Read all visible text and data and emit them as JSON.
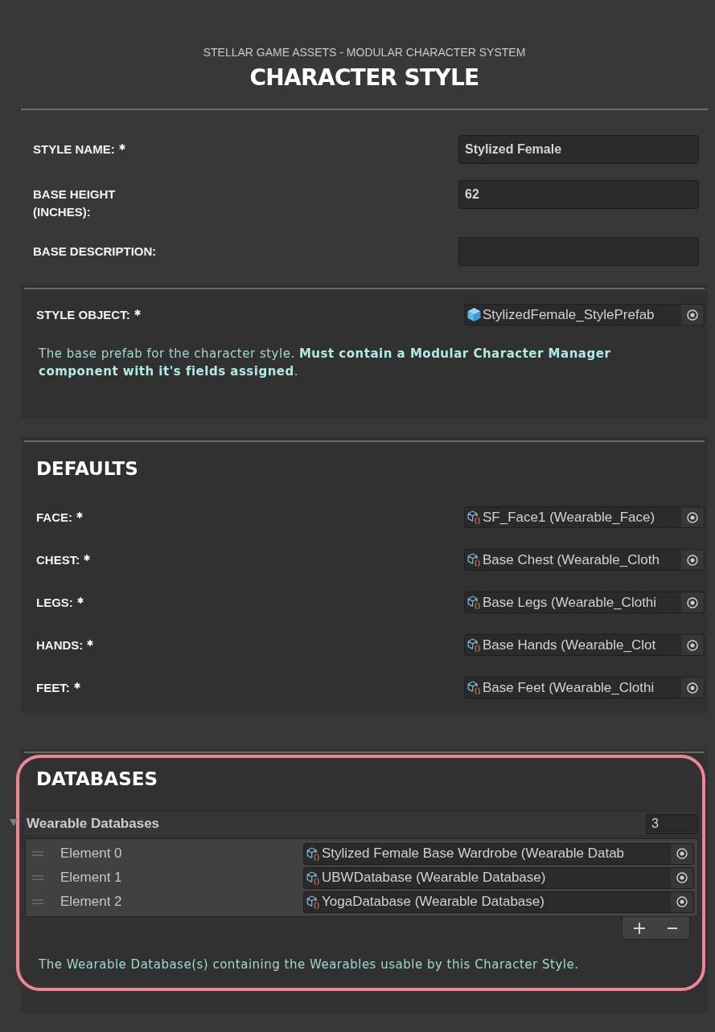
{
  "header": {
    "subtitle": "STELLAR GAME ASSETS - MODULAR CHARACTER SYSTEM",
    "title": "CHARACTER STYLE"
  },
  "fields": [
    {
      "label": "STYLE NAME:",
      "required": true,
      "value": "Stylized Female"
    },
    {
      "label": "BASE HEIGHT\n(INCHES):",
      "required": false,
      "value": "62"
    },
    {
      "label": "BASE DESCRIPTION:",
      "required": false
    }
  ],
  "style_object": {
    "label": "STYLE OBJECT:",
    "required": true,
    "field": {
      "kind": "prefab",
      "value": "StylizedFemale_StylePrefab"
    },
    "description": "The base prefab for the character style. **Must contain a Modular Character Manager component with it's fields assigned**."
  },
  "defaults": {
    "title": "DEFAULTS",
    "rows": [
      {
        "label": "FACE:",
        "required": true,
        "field": {
          "kind": "asset",
          "value": "SF_Face1 (Wearable_Face)"
        }
      },
      {
        "label": "CHEST:",
        "required": true,
        "field": {
          "kind": "asset",
          "value": "Base Chest (Wearable_Cloth"
        }
      },
      {
        "label": "LEGS:",
        "required": true,
        "field": {
          "kind": "asset",
          "value": "Base Legs (Wearable_Clothi"
        }
      },
      {
        "label": "HANDS:",
        "required": true,
        "field": {
          "kind": "asset",
          "value": "Base Hands (Wearable_Clot"
        }
      },
      {
        "label": "FEET:",
        "required": true,
        "field": {
          "kind": "asset",
          "value": "Base Feet (Wearable_Clothi"
        }
      }
    ]
  },
  "databases": {
    "title": "DATABASES",
    "highlighted": true,
    "list": {
      "label": "Wearable Databases",
      "expanded": true,
      "size": "3",
      "elements": [
        {
          "label": "Element 0",
          "field": {
            "kind": "asset",
            "value": "Stylized Female Base Wardrobe (Wearable Datab"
          }
        },
        {
          "label": "Element 1",
          "field": {
            "kind": "asset",
            "value": "UBWDatabase (Wearable Database)"
          }
        },
        {
          "label": "Element 2",
          "field": {
            "kind": "asset",
            "value": "YogaDatabase (Wearable Database)"
          }
        }
      ]
    },
    "description": "The Wearable Database(s) containing the Wearables usable by this Character Style."
  }
}
